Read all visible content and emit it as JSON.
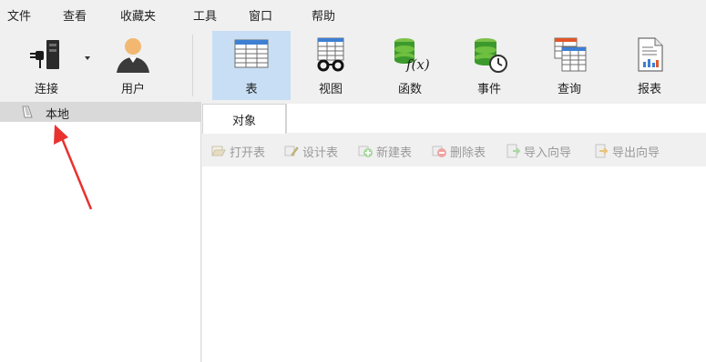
{
  "menubar": {
    "items": [
      "文件",
      "查看",
      "收藏夹",
      "工具",
      "窗口",
      "帮助"
    ]
  },
  "toolbar": {
    "buttons": [
      {
        "label": "连接",
        "icon": "connection-plug-icon",
        "active": false,
        "has_dropdown": true
      },
      {
        "label": "用户",
        "icon": "user-icon",
        "active": false
      },
      {
        "label": "表",
        "icon": "table-icon",
        "active": true
      },
      {
        "label": "视图",
        "icon": "view-glasses-icon",
        "active": false
      },
      {
        "label": "函数",
        "icon": "function-fx-icon",
        "active": false
      },
      {
        "label": "事件",
        "icon": "event-clock-icon",
        "active": false
      },
      {
        "label": "查询",
        "icon": "query-icon",
        "active": false
      },
      {
        "label": "报表",
        "icon": "report-icon",
        "active": false
      }
    ]
  },
  "sidebar": {
    "items": [
      {
        "label": "本地",
        "icon": "connection-leaf-icon",
        "selected": true
      }
    ]
  },
  "tabs": [
    {
      "label": "对象",
      "active": true
    }
  ],
  "object_toolbar": {
    "buttons": [
      {
        "label": "打开表",
        "icon": "open-table-icon",
        "enabled": false
      },
      {
        "label": "设计表",
        "icon": "design-table-icon",
        "enabled": false
      },
      {
        "label": "新建表",
        "icon": "new-table-icon",
        "enabled": false
      },
      {
        "label": "删除表",
        "icon": "delete-table-icon",
        "enabled": false
      },
      {
        "label": "导入向导",
        "icon": "import-wizard-icon",
        "enabled": false
      },
      {
        "label": "导出向导",
        "icon": "export-wizard-icon",
        "enabled": false
      }
    ]
  },
  "colors": {
    "active_toolbar_bg": "#c7def4",
    "selected_tree_bg": "#d9d9d9",
    "annotation_arrow": "#e8322f",
    "disabled_text": "#9a9a9a"
  }
}
